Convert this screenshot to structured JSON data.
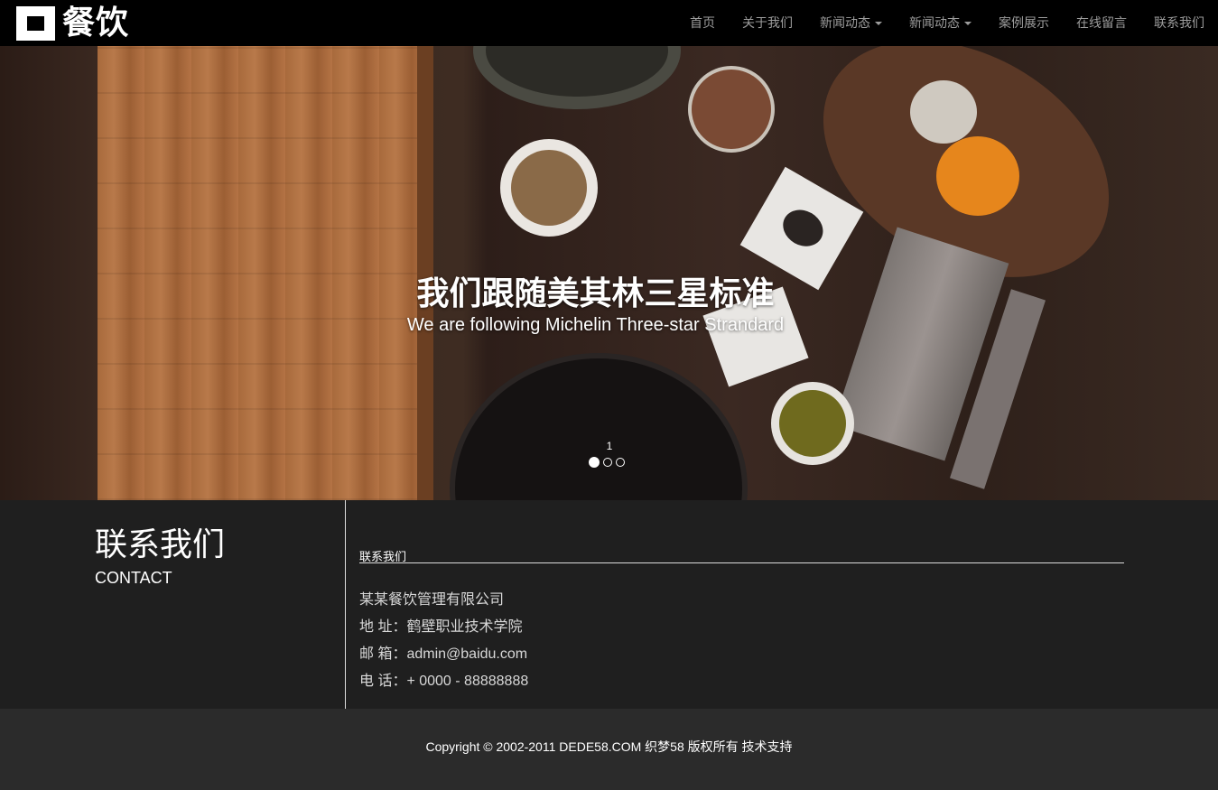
{
  "brand": {
    "logo_text": "餐饮"
  },
  "nav": {
    "items": [
      {
        "label": "首页",
        "dropdown": false
      },
      {
        "label": "关于我们",
        "dropdown": false
      },
      {
        "label": "新闻动态",
        "dropdown": true
      },
      {
        "label": "新闻动态",
        "dropdown": true
      },
      {
        "label": "案例展示",
        "dropdown": false
      },
      {
        "label": "在线留言",
        "dropdown": false
      },
      {
        "label": "联系我们",
        "dropdown": false
      }
    ]
  },
  "hero": {
    "title": "我们跟随美其林三星标准",
    "subtitle": "We are following Michelin Three-star Strandard",
    "slide_number": "1",
    "slide_count": 3,
    "active_slide": 1
  },
  "contact": {
    "title": "联系我们",
    "subtitle": "CONTACT",
    "heading": "联系我们",
    "company": "某某餐饮管理有限公司",
    "address": "地 址：鹤壁职业技术学院",
    "email": "邮 箱：admin@baidu.com",
    "phone": "电 话：+ 0000 - 88888888"
  },
  "footer": {
    "copyright": "Copyright © 2002-2011 DEDE58.COM 织梦58 版权所有 技术支持"
  },
  "colors": {
    "navbar_bg": "#000000",
    "nav_text": "#9d9d9d",
    "contact_bg": "#1f1f1f",
    "footer_bg": "#2b2b2b"
  }
}
